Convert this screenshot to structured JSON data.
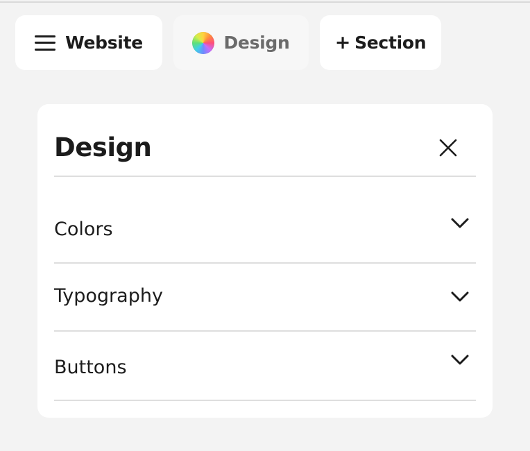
{
  "toolbar": {
    "website_label": "Website",
    "design_label": "Design",
    "section_label": "Section",
    "section_prefix": "+"
  },
  "panel": {
    "title": "Design",
    "sections": [
      {
        "label": "Colors",
        "state": "collapsed"
      },
      {
        "label": "Typography",
        "state": "collapsed"
      },
      {
        "label": "Buttons",
        "state": "collapsed"
      }
    ]
  },
  "icons": {
    "menu": "hamburger-menu-icon",
    "design": "color-wheel-icon",
    "close": "close-icon",
    "expand": "chevron-down-icon"
  },
  "colors": {
    "background": "#f3f3f3",
    "surface": "#ffffff",
    "text": "#1c1c1c",
    "muted_text": "#6b6b6b",
    "divider": "#dedede"
  }
}
